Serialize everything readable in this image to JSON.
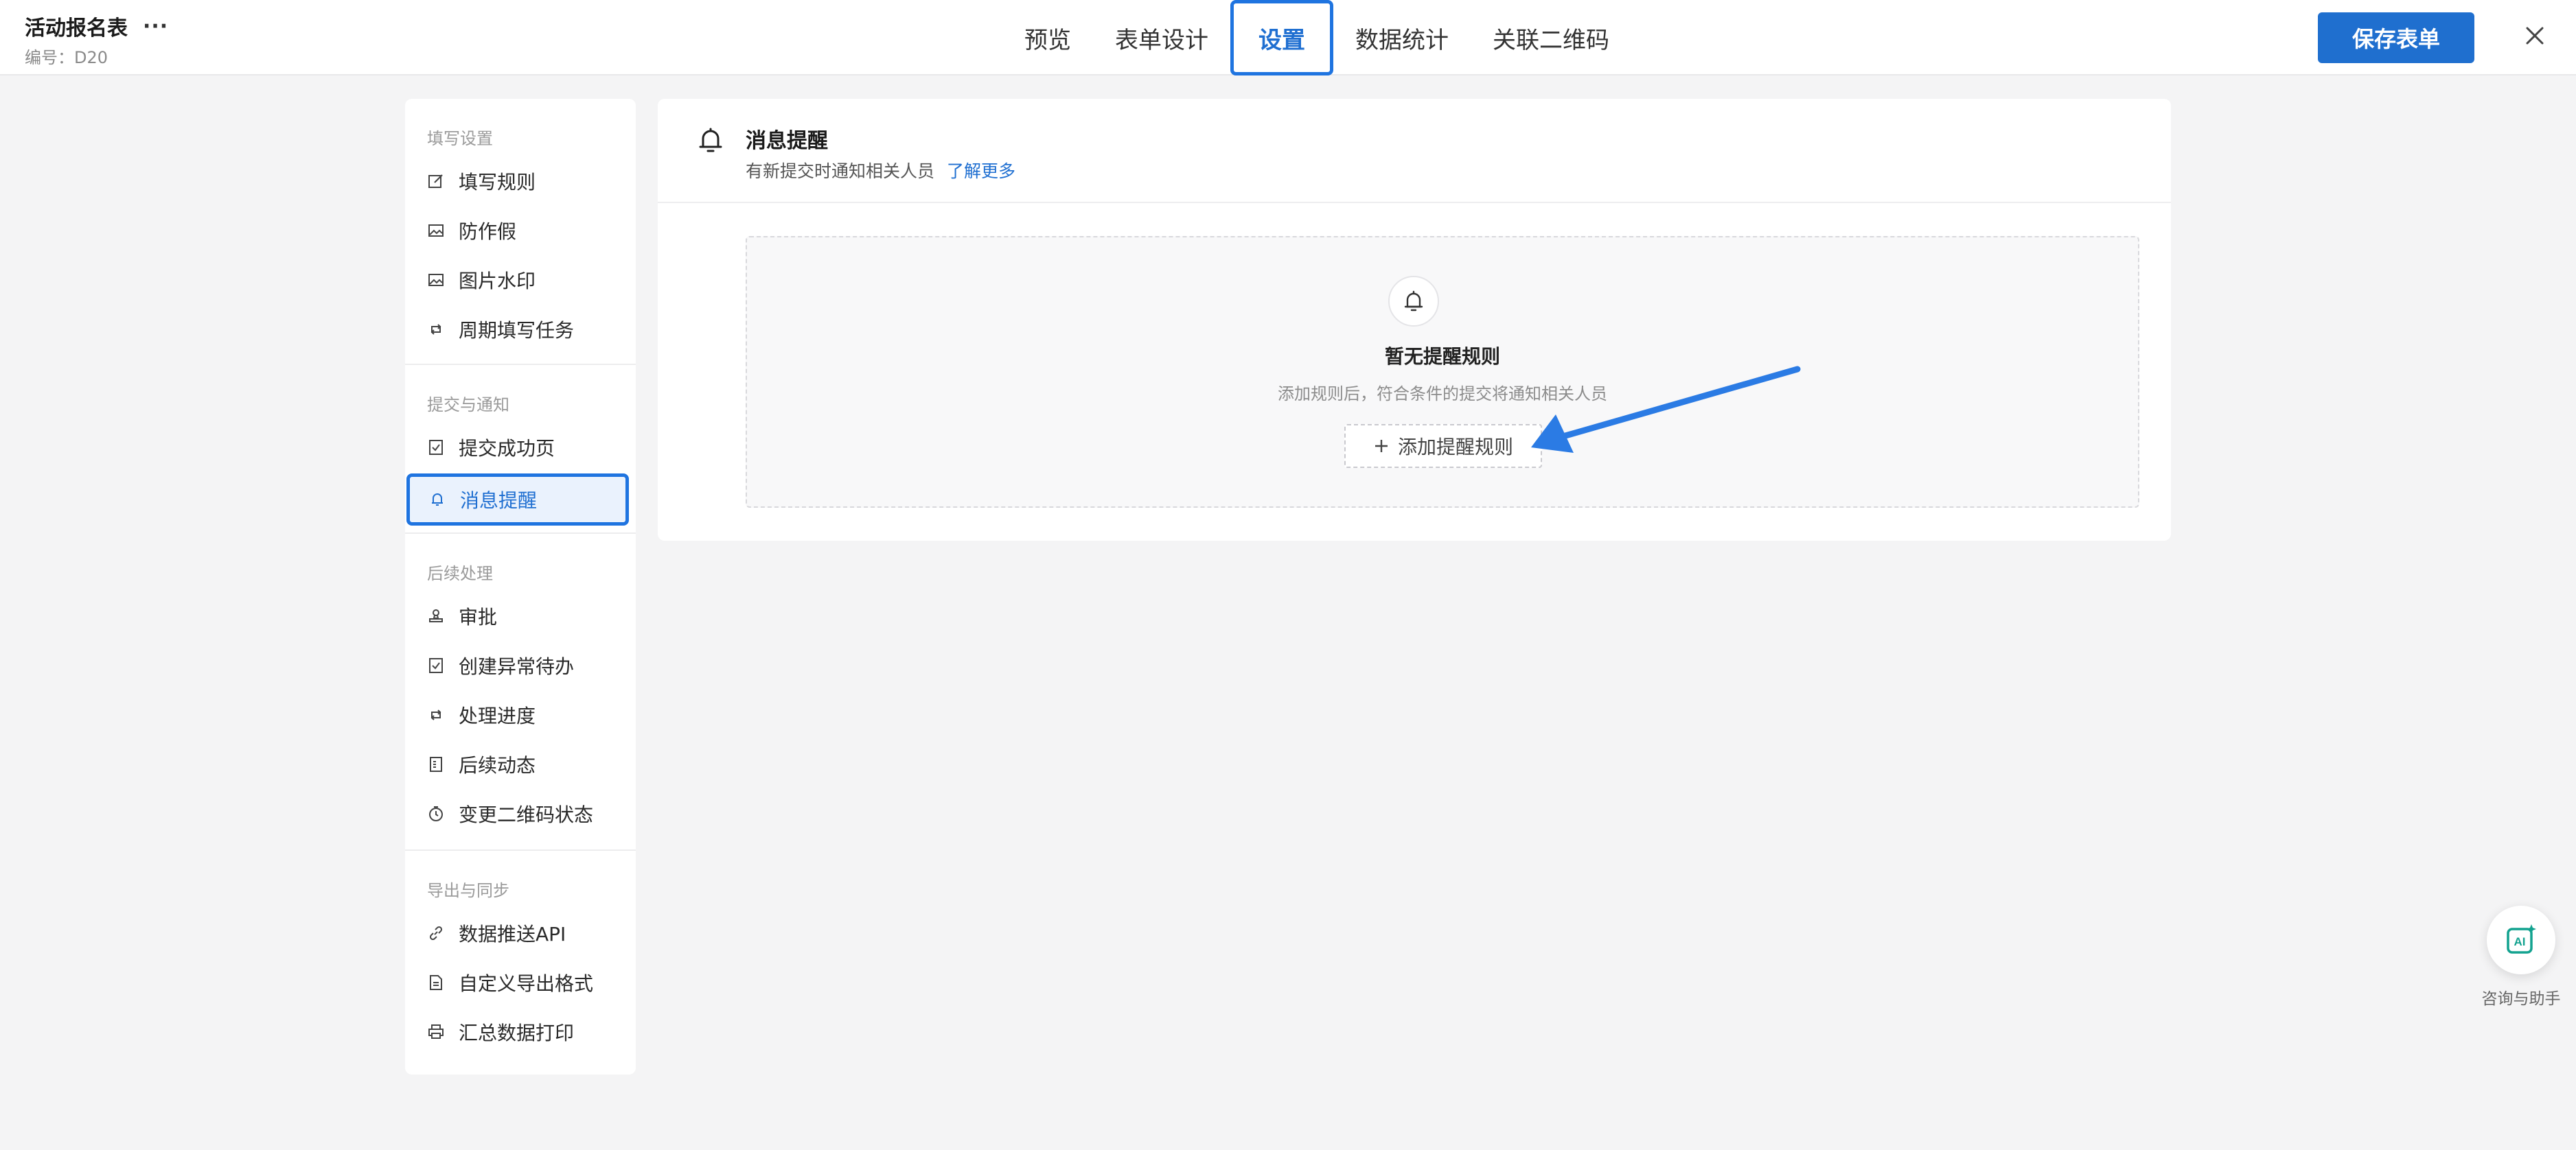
{
  "header": {
    "title": "活动报名表",
    "more": "···",
    "code": "编号：D20",
    "tabs": [
      {
        "label": "预览"
      },
      {
        "label": "表单设计"
      },
      {
        "label": "设置"
      },
      {
        "label": "数据统计"
      },
      {
        "label": "关联二维码"
      }
    ],
    "active_tab": "设置",
    "save_label": "保存表单"
  },
  "sidebar": {
    "sections": [
      {
        "title": "填写设置",
        "items": [
          {
            "label": "填写规则",
            "icon": "edit-icon"
          },
          {
            "label": "防作假",
            "icon": "image-icon"
          },
          {
            "label": "图片水印",
            "icon": "image-icon"
          },
          {
            "label": "周期填写任务",
            "icon": "cycle-icon"
          }
        ]
      },
      {
        "title": "提交与通知",
        "items": [
          {
            "label": "提交成功页",
            "icon": "check-doc-icon"
          },
          {
            "label": "消息提醒",
            "icon": "bell-icon",
            "active": true
          }
        ]
      },
      {
        "title": "后续处理",
        "items": [
          {
            "label": "审批",
            "icon": "stamp-icon"
          },
          {
            "label": "创建异常待办",
            "icon": "check-doc-icon"
          },
          {
            "label": "处理进度",
            "icon": "cycle-icon"
          },
          {
            "label": "后续动态",
            "icon": "list-doc-icon"
          },
          {
            "label": "变更二维码状态",
            "icon": "clock-icon"
          }
        ]
      },
      {
        "title": "导出与同步",
        "items": [
          {
            "label": "数据推送API",
            "icon": "link-icon"
          },
          {
            "label": "自定义导出格式",
            "icon": "doc-icon"
          },
          {
            "label": "汇总数据打印",
            "icon": "printer-icon"
          }
        ]
      }
    ]
  },
  "panel": {
    "title": "消息提醒",
    "desc": "有新提交时通知相关人员",
    "learn_more": "了解更多",
    "empty_title": "暂无提醒规则",
    "empty_desc": "添加规则后，符合条件的提交将通知相关人员",
    "add_rule_label": "添加提醒规则"
  },
  "assistant": {
    "label": "咨询与助手",
    "icon_text": "AI"
  },
  "colors": {
    "accent": "#1f6fd1",
    "annotation_arrow": "#2b7be4",
    "background": "#f4f4f5"
  }
}
